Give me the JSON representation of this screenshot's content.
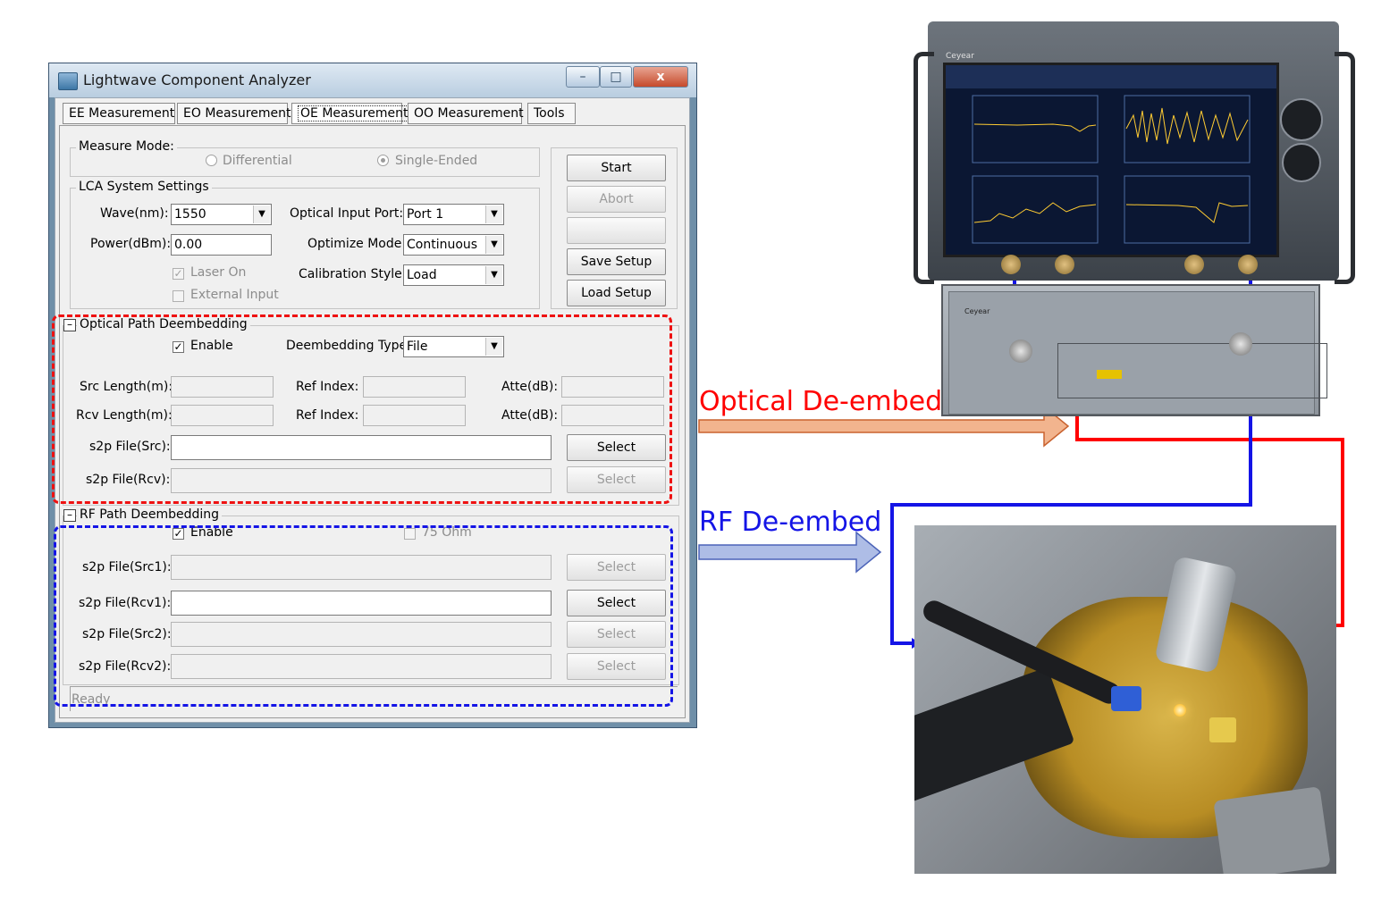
{
  "window": {
    "title": "Lightwave Component Analyzer",
    "minimize_glyph": "–",
    "maximize_glyph": "□",
    "close_glyph": "x"
  },
  "tabs": [
    {
      "label": "EE Measurement"
    },
    {
      "label": "EO Measurement"
    },
    {
      "label": "OE Measurement",
      "active": true
    },
    {
      "label": "OO Measurement"
    },
    {
      "label": "Tools"
    }
  ],
  "measure_mode": {
    "group_label": "Measure Mode:",
    "options": [
      "Differential",
      "Single-Ended"
    ],
    "selected": "Single-Ended"
  },
  "lca": {
    "group_label": "LCA System Settings",
    "wave_label": "Wave(nm):",
    "wave_value": "1550",
    "power_label": "Power(dBm):",
    "power_value": "0.00",
    "laser_on_label": "Laser On",
    "external_input_label": "External Input",
    "optical_port_label": "Optical Input Port:",
    "optical_port_value": "Port 1",
    "optimize_label": "Optimize Mode:",
    "optimize_value": "Continuous",
    "calib_label": "Calibration Style:",
    "calib_value": "Load"
  },
  "side_buttons": {
    "start": "Start",
    "abort": "Abort",
    "save": "Save Setup",
    "load": "Load Setup"
  },
  "optical": {
    "group_label": "Optical Path Deembedding",
    "enable_label": "Enable",
    "type_label": "Deembedding Type",
    "type_value": "File",
    "src_length_label": "Src Length(m):",
    "rcv_length_label": "Rcv Length(m):",
    "ref_index_label": "Ref Index:",
    "atte_label": "Atte(dB):",
    "s2p_src_label": "s2p File(Src):",
    "s2p_rcv_label": "s2p File(Rcv):",
    "select_label": "Select"
  },
  "rf": {
    "group_label": "RF Path Deembedding",
    "enable_label": "Enable",
    "ohm_label": "75 Ohm",
    "src1_label": "s2p File(Src1):",
    "rcv1_label": "s2p File(Rcv1):",
    "src2_label": "s2p File(Src2):",
    "rcv2_label": "s2p File(Rcv2):",
    "select_label": "Select"
  },
  "status": {
    "text": "Ready"
  },
  "annotations": {
    "optical_label": "Optical De-embed",
    "rf_label": "RF De-embed",
    "optical_color": "#ff0000",
    "rf_color": "#1414e6",
    "optical_arrow_color": "#f2b48e",
    "rf_arrow_color": "#aebde6"
  },
  "instrument": {
    "brand": "Ceyear"
  }
}
